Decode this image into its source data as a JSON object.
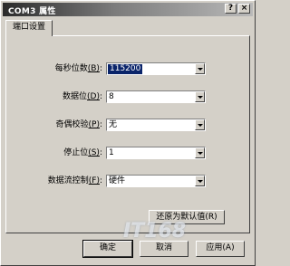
{
  "window": {
    "title": "COM3 属性",
    "help_button": "?",
    "close_button": "×"
  },
  "tabs": [
    {
      "label": "端口设置"
    }
  ],
  "settings": [
    {
      "label": "每秒位数",
      "accel": "(B)",
      "value": "115200"
    },
    {
      "label": "数据位",
      "accel": "(D)",
      "value": "8"
    },
    {
      "label": "奇偶校验",
      "accel": "(P)",
      "value": "无"
    },
    {
      "label": "停止位",
      "accel": "(S)",
      "value": "1"
    },
    {
      "label": "数据流控制",
      "accel": "(F)",
      "value": "硬件"
    }
  ],
  "restore_defaults_label": "还原为默认值(R)",
  "buttons": {
    "ok": "确定",
    "cancel": "取消",
    "apply": "应用(A)"
  },
  "watermark": "IT168"
}
